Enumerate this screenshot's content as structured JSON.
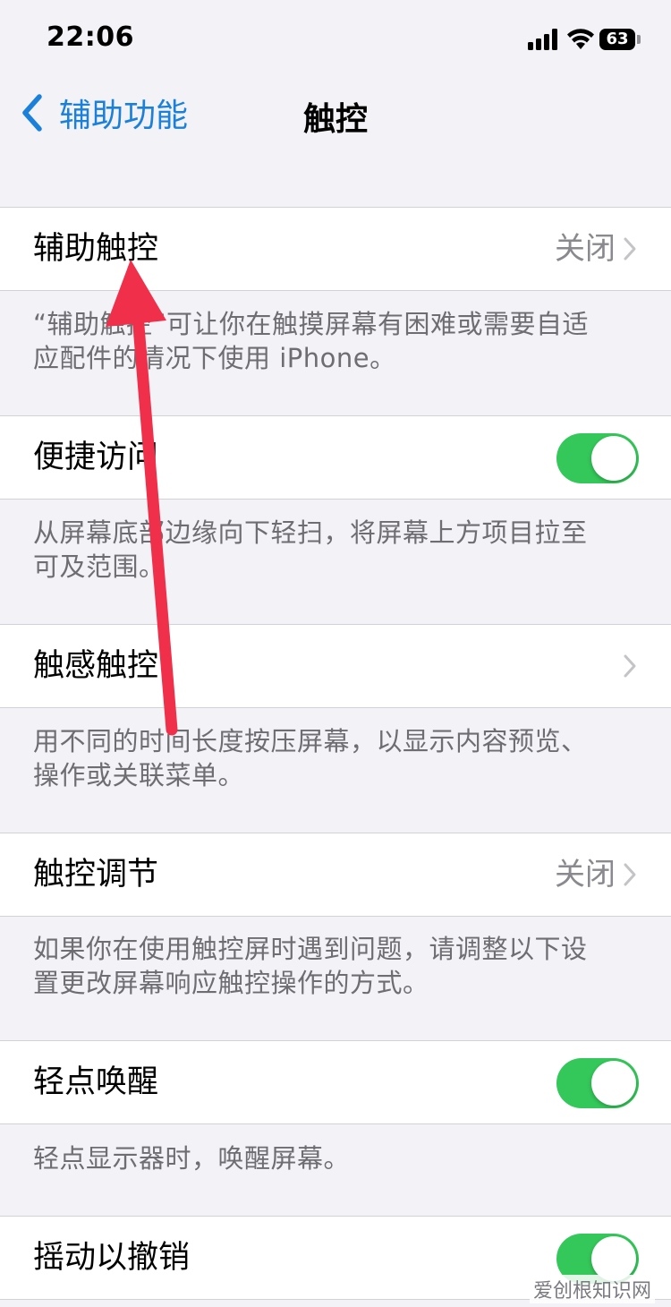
{
  "status_bar": {
    "time": "22:06",
    "battery": "63"
  },
  "nav": {
    "back_label": "辅助功能",
    "title": "触控"
  },
  "rows": [
    {
      "label": "辅助触控",
      "value": "关闭"
    },
    {
      "label": "便捷访问"
    },
    {
      "label": "触感触控"
    },
    {
      "label": "触控调节",
      "value": "关闭"
    },
    {
      "label": "轻点唤醒"
    },
    {
      "label": "摇动以撤销"
    }
  ],
  "footers": [
    [
      "“辅助触控”可让你在触摸屏幕有困难或需要自适",
      "应配件的情况下使用 iPhone。"
    ],
    [
      "从屏幕底部边缘向下轻扫，将屏幕上方项目拉至",
      "可及范围。"
    ],
    [
      "用不同的时间长度按压屏幕，以显示内容预览、",
      "操作或关联菜单。"
    ],
    [
      "如果你在使用触控屏时遇到问题，请调整以下设",
      "置更改屏幕响应触控操作的方式。"
    ],
    [
      "轻点显示器时，唤醒屏幕。"
    ]
  ],
  "toggles": {
    "reachability": true,
    "tap_to_wake": true,
    "shake_to_undo": true
  },
  "watermark": "爱创根知识网",
  "colors": {
    "accent": "#1a80d9",
    "toggle_on": "#34c759",
    "annotation": "#f0304a"
  }
}
